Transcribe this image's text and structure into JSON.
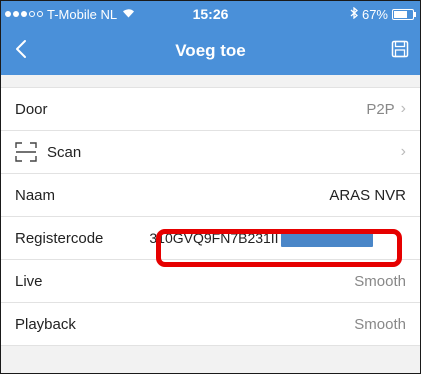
{
  "status_bar": {
    "carrier": "T-Mobile NL",
    "time": "15:26",
    "battery": "67%",
    "signal_icon": "signal-dots-icon",
    "wifi_icon": "wifi-icon",
    "bluetooth_icon": "bluetooth-icon",
    "battery_icon": "battery-icon",
    "battery_level": 0.67
  },
  "navbar": {
    "title": "Voeg toe",
    "back_icon": "chevron-left-icon",
    "save_icon": "save-icon"
  },
  "rows": {
    "door": {
      "label": "Door",
      "value": "P2P"
    },
    "scan": {
      "label": "Scan",
      "icon": "scan-icon"
    },
    "naam": {
      "label": "Naam",
      "value": "ARAS NVR"
    },
    "registercode": {
      "label": "Registercode",
      "value": "310GVQ9FN7B231II"
    },
    "live": {
      "label": "Live",
      "value": "Smooth"
    },
    "playback": {
      "label": "Playback",
      "value": "Smooth"
    }
  },
  "colors": {
    "bar_blue": "#4a90d9",
    "highlight_red": "#e60000",
    "redaction_blue": "#4a86c8"
  }
}
